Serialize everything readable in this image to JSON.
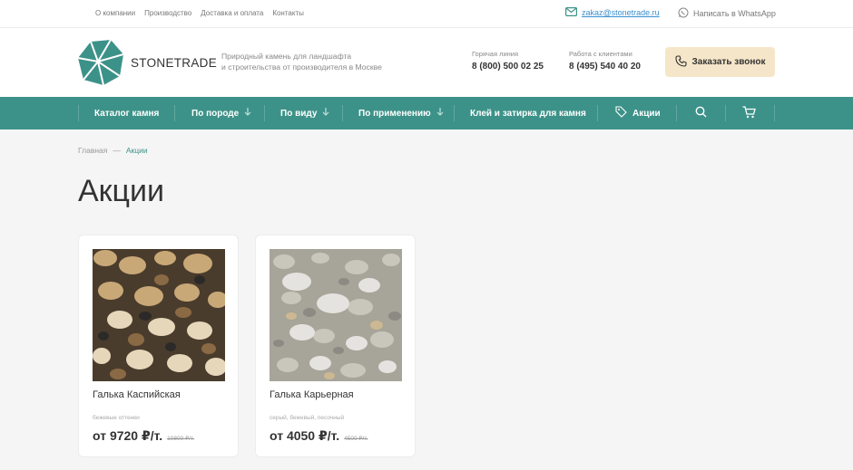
{
  "topbar": {
    "links": [
      "О компании",
      "Производство",
      "Доставка и оплата",
      "Контакты"
    ],
    "email": "zakaz@stonetrade.ru",
    "whatsapp": "Написать в WhatsApp"
  },
  "header": {
    "brand": "STONETRADE",
    "tagline_1": "Природный камень для ландшафта",
    "tagline_2": "и строительства от производителя в Москве",
    "hotline_label": "Горячая линия",
    "hotline_number": "8 (800) 500 02 25",
    "clients_label": "Работа с клиентами",
    "clients_number": "8 (495) 540 40 20",
    "call_button": "Заказать звонок"
  },
  "nav": {
    "catalog": "Каталог камня",
    "by_rock": "По породе",
    "by_type": "По виду",
    "by_use": "По применению",
    "glue": "Клей и затирка для камня",
    "promo": "Акции"
  },
  "breadcrumb": {
    "home": "Главная",
    "sep": "—",
    "current": "Акции"
  },
  "page_title": "Акции",
  "products": [
    {
      "name": "Галька Каспийская",
      "color": "бежевые оттенки",
      "price": "от 9720 ₽/т.",
      "old_price": "10800 ₽/т."
    },
    {
      "name": "Галька Карьерная",
      "color": "серый, бежевый, песочный",
      "price": "от 4050 ₽/т.",
      "old_price": "4500 ₽/т."
    }
  ],
  "colors": {
    "accent": "#3c9288",
    "button": "#f6e6c9",
    "link": "#3a8fd0"
  }
}
